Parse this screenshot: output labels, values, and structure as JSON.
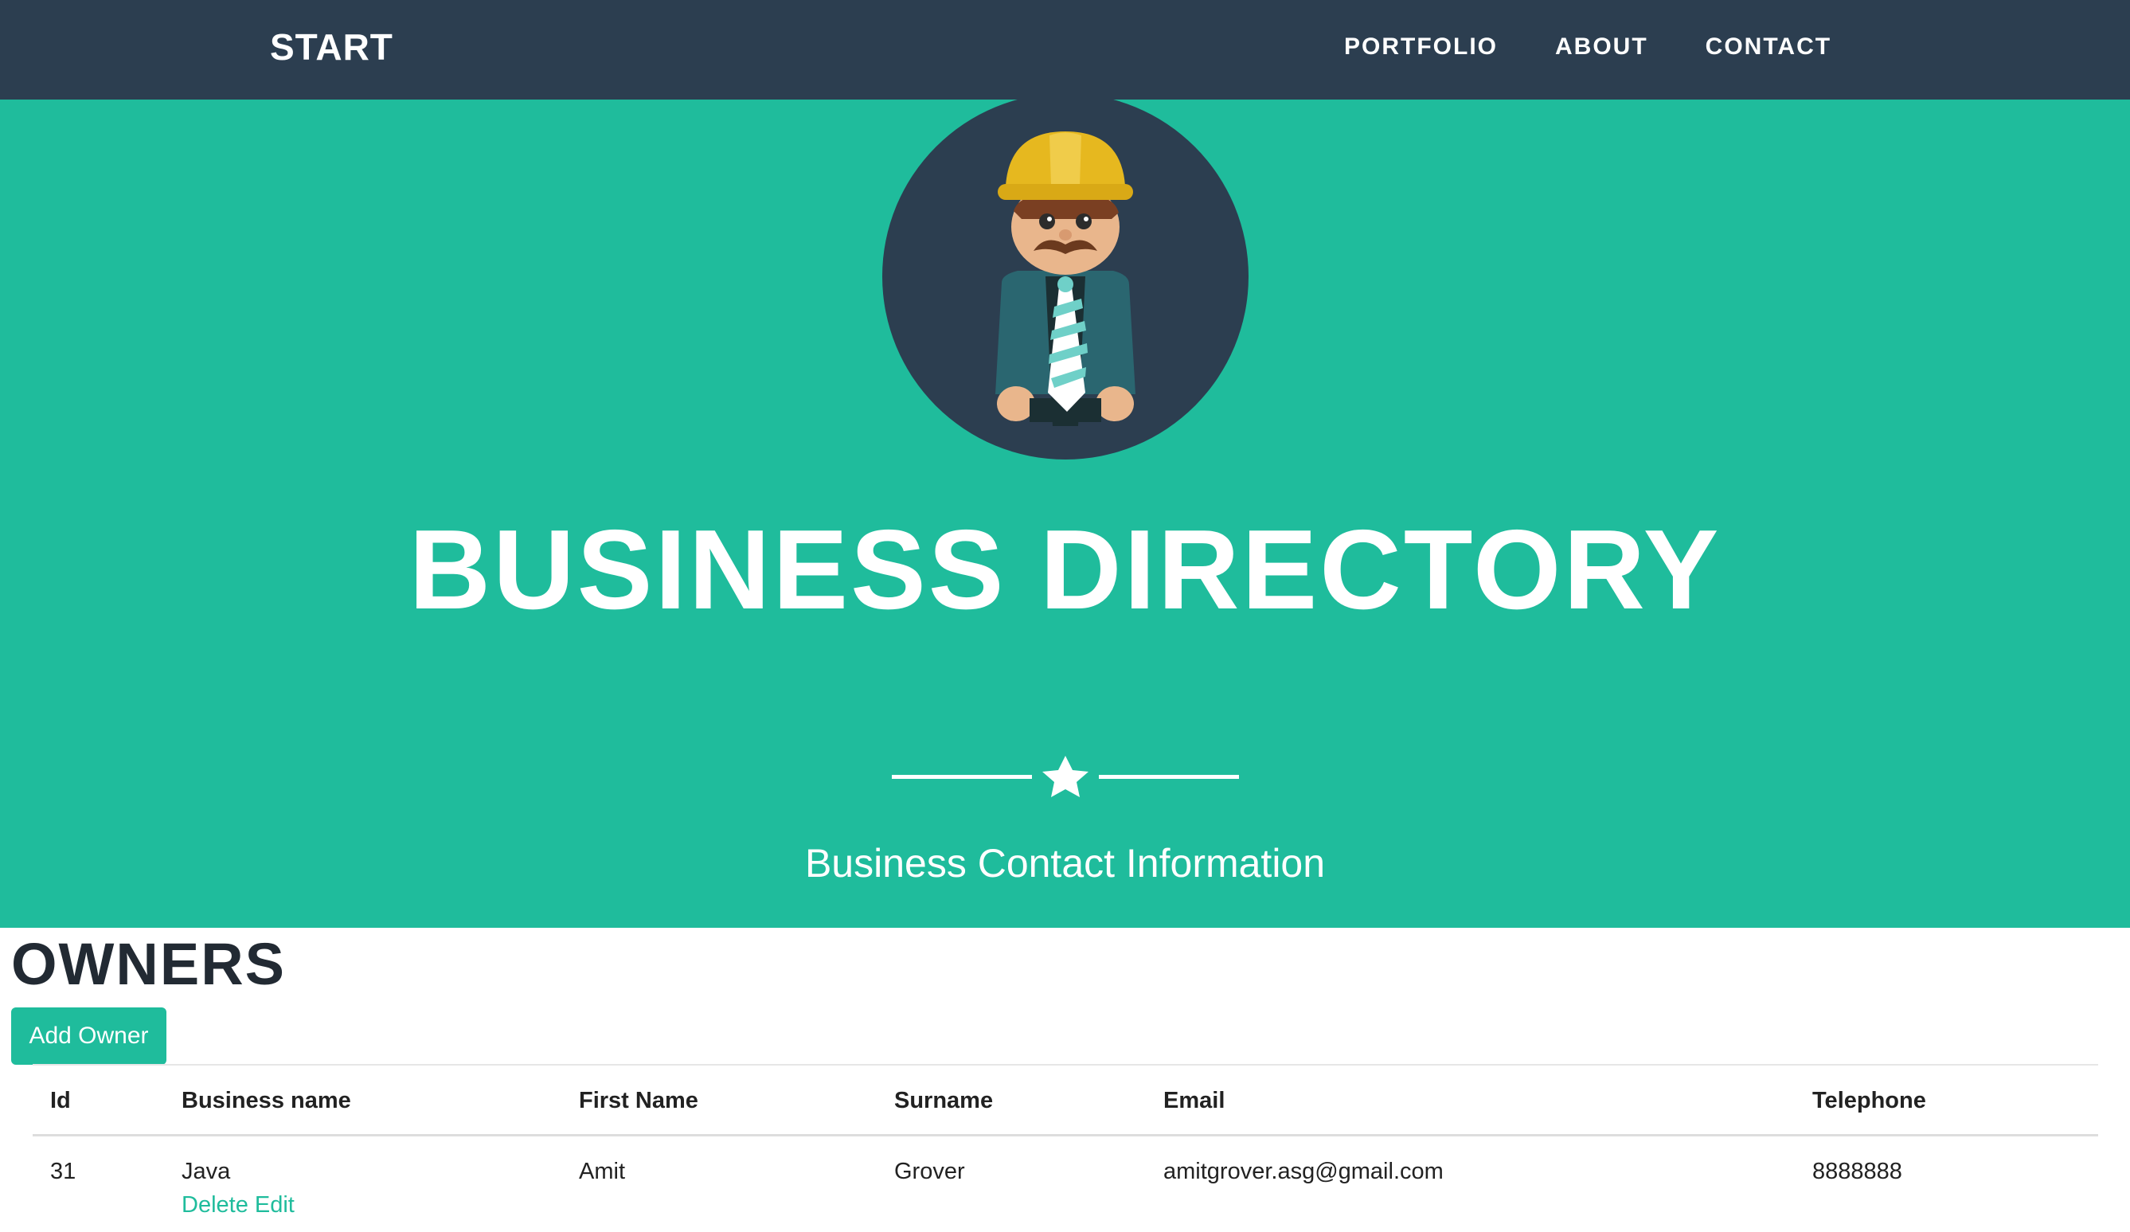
{
  "navbar": {
    "brand": "START",
    "links": [
      "PORTFOLIO",
      "ABOUT",
      "CONTACT"
    ]
  },
  "hero": {
    "avatar_icon": "builder-avatar-icon",
    "title": "BUSINESS DIRECTORY",
    "divider_icon": "star-icon",
    "subtitle": "Business Contact Information"
  },
  "owners": {
    "heading": "OWNERS",
    "add_button": "Add Owner",
    "columns": [
      "Id",
      "Business name",
      "First Name",
      "Surname",
      "Email",
      "Telephone"
    ],
    "rows": [
      {
        "id": "31",
        "business_name": "Java",
        "first_name": "Amit",
        "surname": "Grover",
        "email": "amitgrover.asg@gmail.com",
        "telephone": "8888888",
        "delete_label": "Delete",
        "edit_label": "Edit"
      }
    ]
  },
  "colors": {
    "navbar": "#2c3e50",
    "accent": "#1fbc9c",
    "text": "#222222"
  }
}
